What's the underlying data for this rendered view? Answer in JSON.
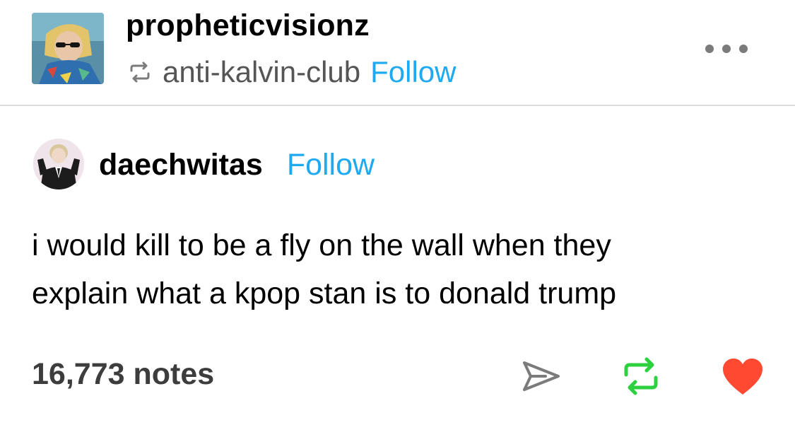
{
  "post_header": {
    "poster_username": "propheticvisionz",
    "reblogged_from": "anti-kalvin-club",
    "follow_label": "Follow",
    "more_icon": "more-horizontal-icon",
    "reblog_icon": "reblog-icon"
  },
  "original_post": {
    "author_username": "daechwitas",
    "follow_label": "Follow",
    "body_lines": [
      "i would kill to be a fly on the wall when they",
      "explain what a kpop stan is to donald trump"
    ]
  },
  "footer": {
    "notes_label": "16,773 notes",
    "actions": {
      "share_icon": "share-icon",
      "reblog_icon": "reblog-icon",
      "like_icon": "heart-icon"
    }
  },
  "colors": {
    "follow_link": "#1eaaf1",
    "reblog_active": "#2dd13f",
    "like_active": "#ff4930",
    "notes_text": "#3d3d3d",
    "reblog_source_text": "#555555",
    "icon_gray": "#7b7b7b",
    "divider": "#dcdcdc"
  }
}
